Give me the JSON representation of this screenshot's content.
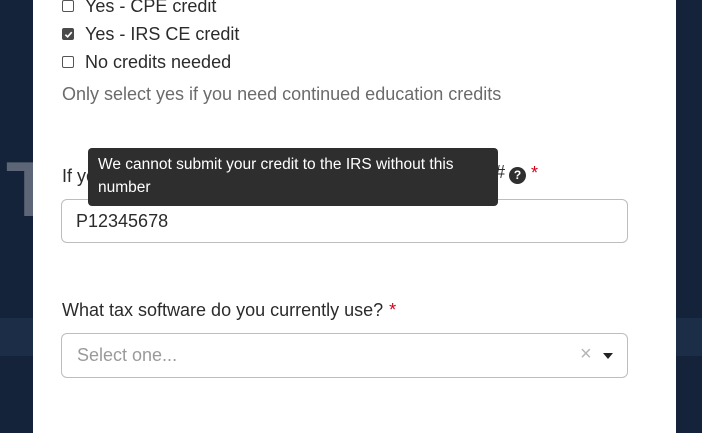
{
  "background": {
    "letter": "T"
  },
  "credits": {
    "options": [
      {
        "label": "Yes - CPE credit",
        "checked": false
      },
      {
        "label": "Yes - IRS CE credit",
        "checked": true
      },
      {
        "label": "No credits needed",
        "checked": false
      }
    ],
    "hint": "Only select yes if you need continued education credits"
  },
  "ptin": {
    "label_start": "If yo",
    "label_end": "#",
    "required_mark": "*",
    "value": "P12345678",
    "help_icon": "question-circle-icon",
    "tooltip": "We cannot submit your credit to the IRS without this number"
  },
  "software": {
    "label": "What tax software do you currently use?",
    "required_mark": "*",
    "placeholder": "Select one...",
    "clear_symbol": "×",
    "caret_icon": "caret-down-icon"
  },
  "colors": {
    "background": "#15233a",
    "modal": "#ffffff",
    "required": "#d0021b",
    "tooltip": "#2e2e2e"
  }
}
